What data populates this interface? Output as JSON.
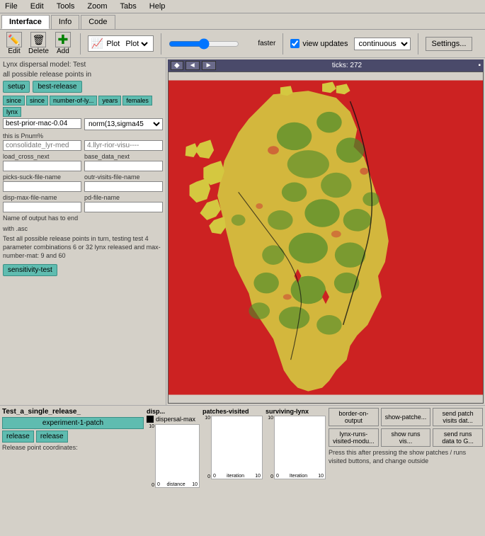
{
  "menubar": {
    "items": [
      "File",
      "Edit",
      "Tools",
      "Zoom",
      "Tabs",
      "Help"
    ]
  },
  "tabs": {
    "items": [
      "Interface",
      "Info",
      "Code"
    ],
    "active": "Interface"
  },
  "toolbar": {
    "edit_label": "Edit",
    "delete_label": "Delete",
    "add_label": "Add",
    "plot_label": "Plot",
    "faster_label": "faster",
    "view_updates_label": "view updates",
    "continuous_label": "continuous",
    "settings_label": "Settings..."
  },
  "left_panel": {
    "title_line1": "Lynx dispersal model: Test",
    "title_line2": "all possible release points in",
    "setup_label": "setup",
    "best_release_label": "best-release",
    "small_buttons": [
      "since",
      "since",
      "number-of-ly...",
      "years",
      "females",
      "lynx"
    ],
    "dropdown1_value": "best-prior-mac-0.04",
    "dropdown2_value": "norm(13,sigma45",
    "this_is_label": "this is Pnum%",
    "input1_label": "consolidate_lyr-med",
    "input2_label": "4.llyr-rior-visu----",
    "load_cross_next_label": "load_cross_next",
    "base_data_next_label": "base_data_next",
    "picks_suck_file_name_label": "picks-suck-file-name",
    "outr_visits_file_name_label": "outr-visits-file-name",
    "disp_max_file_name_label": "disp-max-file-name",
    "pd_file_name_label": "pd-file-name",
    "note1": "Name of output has to end",
    "note2": "with .asc",
    "desc_text": "Test all possible release points in turn, testing test 4 parameter combinations 6 or 32 lynx released and max-number-mat: 9 and 60",
    "sensitivity_test_label": "sensitivity-test"
  },
  "map": {
    "title": "ticks: 272",
    "nav_left": "◄",
    "nav_right": "►",
    "nav_solid": "◆"
  },
  "bottom_panel": {
    "release_title": "Test_a_single_release_",
    "experiment_label": "experiment-1-patch",
    "release1_label": "release",
    "release2_label": "release",
    "release_point_coords": "Release point coordinates:",
    "disp_title": "disp...",
    "dispersal_max_label": "dispersal-max",
    "patches_visited_title": "patches-visited",
    "iteration_label": "iteration",
    "surviving_lynx_title": "surviving-lynx",
    "iteration_label2": "iteration",
    "chart_max": "10",
    "chart_min": "0",
    "iter_max": "10",
    "iter_min": "0",
    "right_buttons": {
      "border_output": "border-on-output",
      "show_patches": "show-patche...",
      "send_patch_visits": "send patch visits dat...",
      "lynx_runs_visited": "lynx-runs-visited-modu...",
      "show_runs_vis": "show runs vis...",
      "send_runs_data": "send runs data to G...",
      "desc": "Press this after pressing the show patches / runs visited buttons, and change outside"
    }
  }
}
